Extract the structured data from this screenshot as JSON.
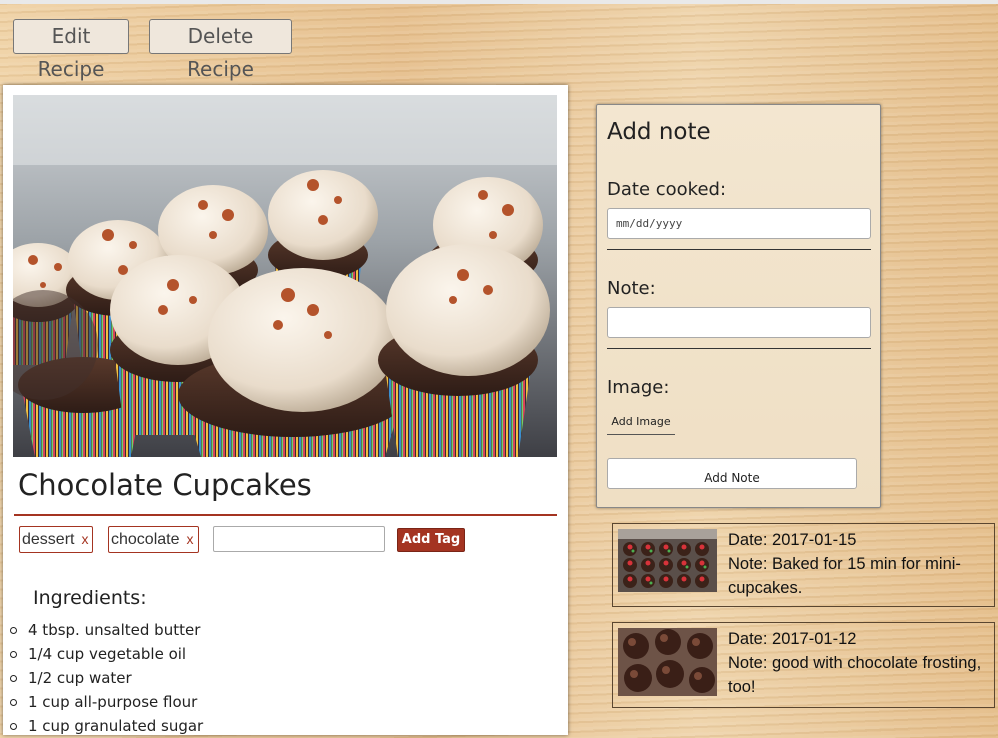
{
  "toolbar": {
    "edit_label": "Edit Recipe",
    "delete_label": "Delete Recipe"
  },
  "recipe": {
    "title": "Chocolate Cupcakes",
    "tags": [
      {
        "label": "dessert",
        "remove": "x"
      },
      {
        "label": "chocolate",
        "remove": "x"
      }
    ],
    "tag_input_value": "",
    "add_tag_label": "Add Tag",
    "ingredients_heading": "Ingredients:",
    "ingredients": [
      "4 tbsp. unsalted butter",
      "1/4 cup vegetable oil",
      "1/2 cup water",
      "1 cup all-purpose flour",
      "1 cup granulated sugar"
    ]
  },
  "add_note": {
    "title": "Add note",
    "date_label": "Date cooked:",
    "date_placeholder": "mm/dd/yyyy",
    "note_label": "Note:",
    "note_value": "",
    "image_label": "Image:",
    "add_image_label": "Add Image",
    "submit_label": "Add Note"
  },
  "notes": [
    {
      "date": "Date: 2017-01-15",
      "note": "Note: Baked for 15 min for mini-cupcakes."
    },
    {
      "date": "Date: 2017-01-12",
      "note": "Note: good with chocolate frosting, too!"
    }
  ]
}
